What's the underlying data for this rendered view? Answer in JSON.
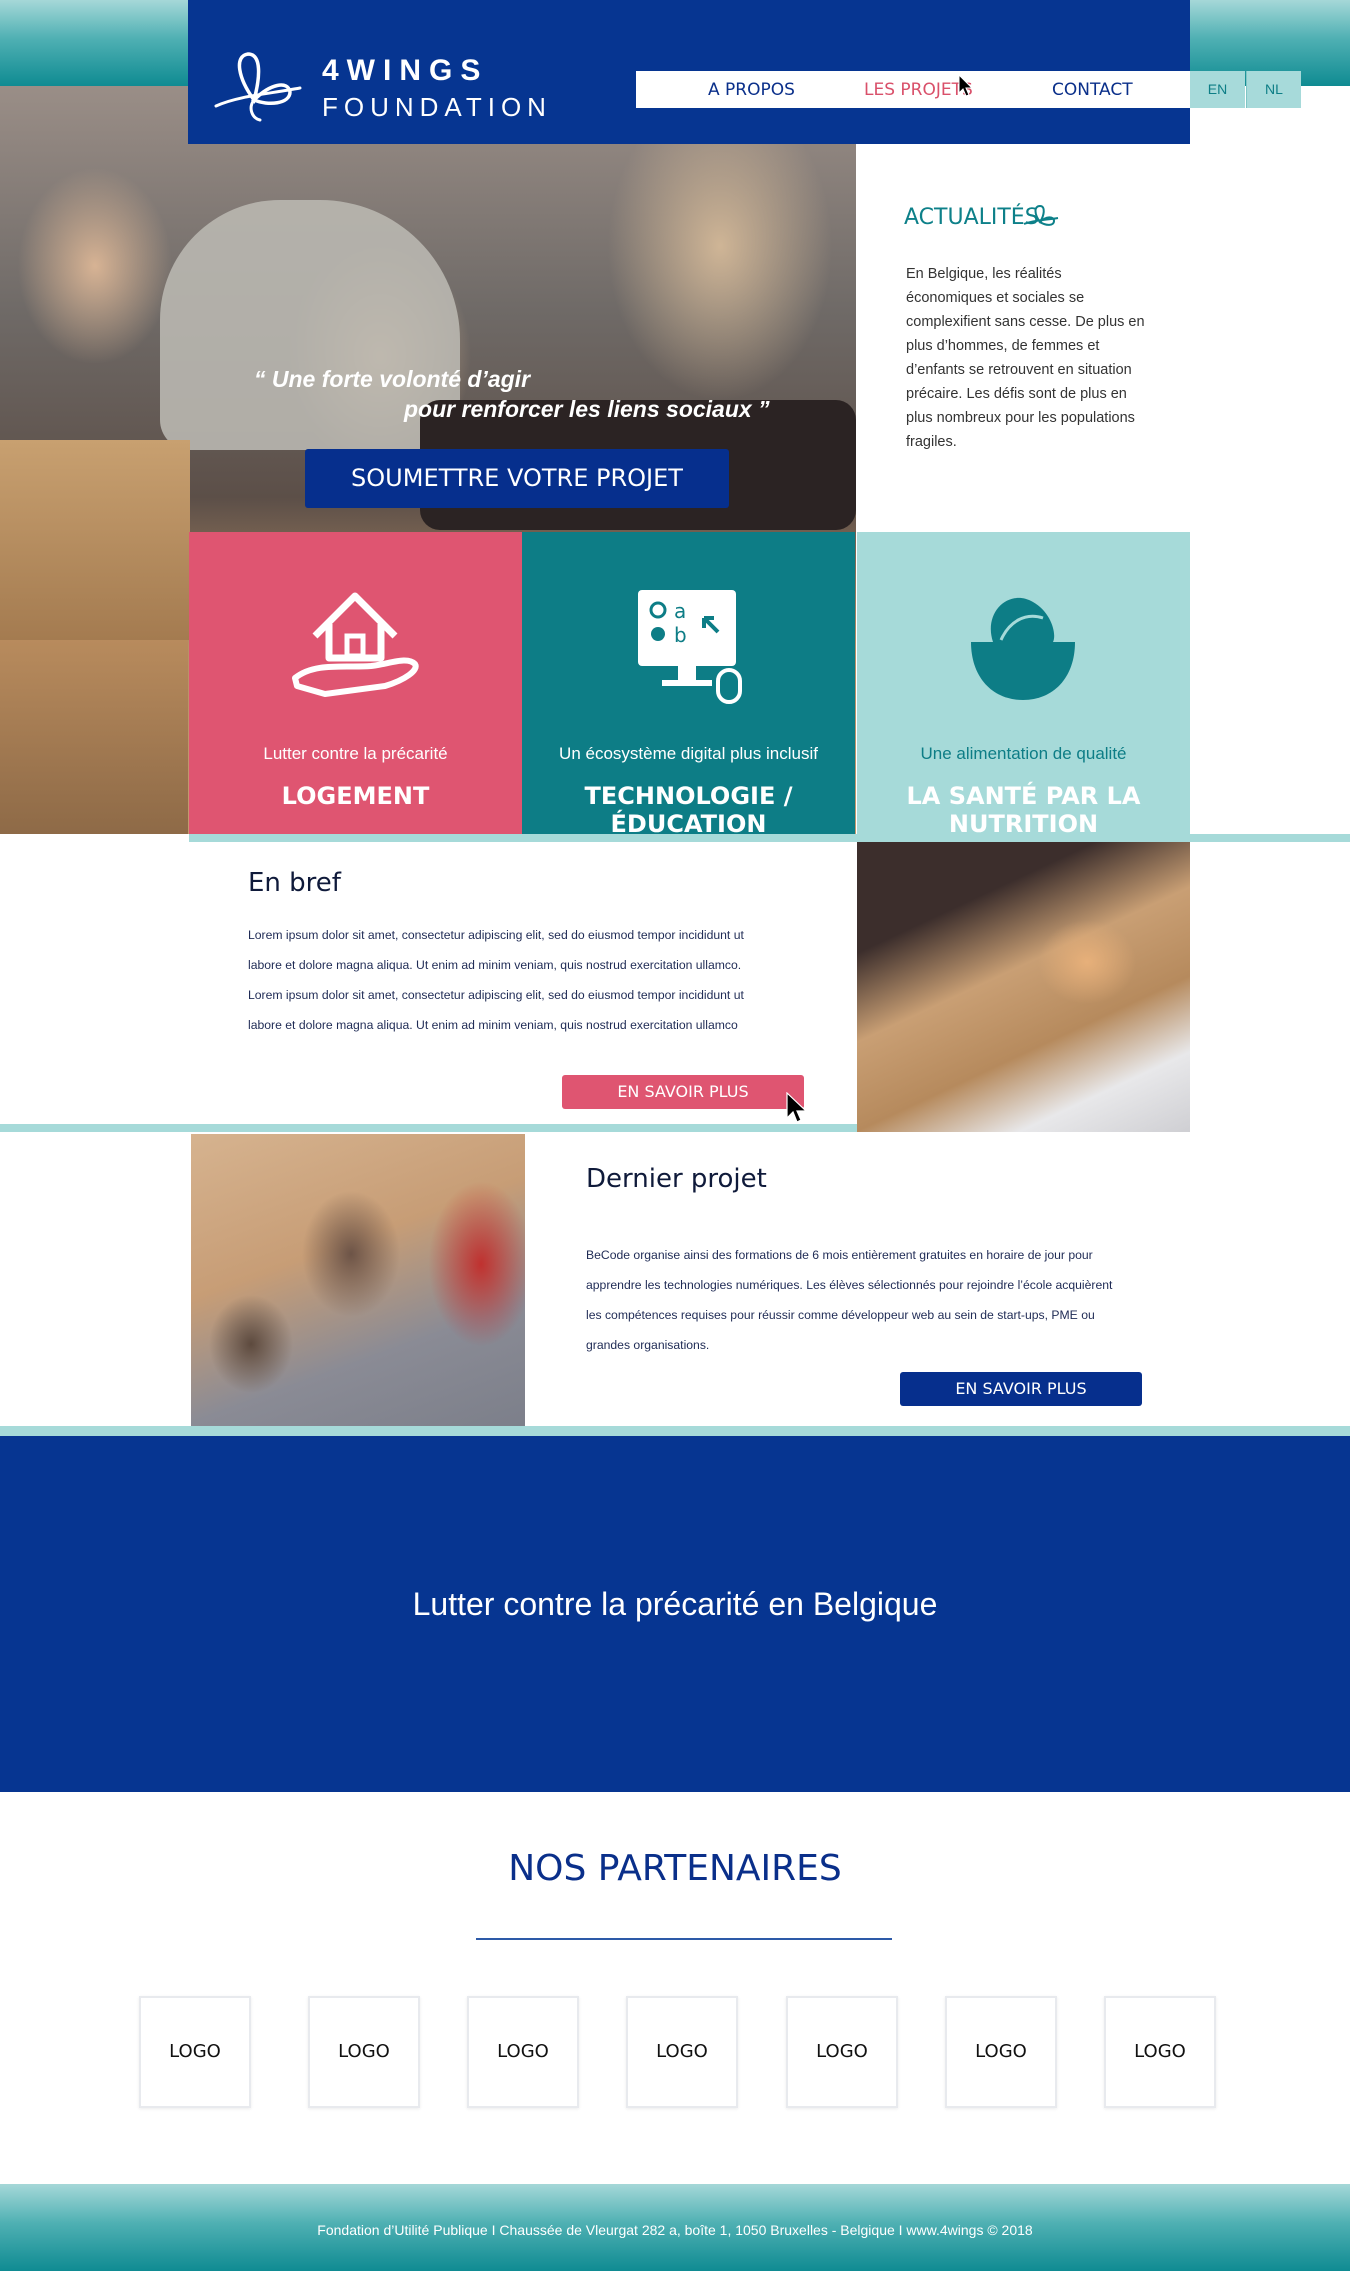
{
  "brand": {
    "line1": "4WINGS",
    "line2": "FOUNDATION"
  },
  "nav": [
    {
      "label": "A PROPOS"
    },
    {
      "label": "LES PROJETS"
    },
    {
      "label": "CONTACT"
    }
  ],
  "languages": [
    "EN",
    "NL"
  ],
  "hero": {
    "quote_line1": "“ Une forte volonté d’agir",
    "quote_line2": "pour renforcer les liens sociaux ”",
    "cta": "SOUMETTRE VOTRE PROJET"
  },
  "news": {
    "title": "ACTUALITÉS",
    "text": "En Belgique, les réalités économiques et sociales se complexifient sans cesse. De plus en plus d’hommes, de femmes et d’enfants se retrouvent en situation précaire. Les défis sont de plus en plus nombreux pour les populations fragiles."
  },
  "categories": [
    {
      "caption": "Lutter contre la précarité",
      "title": "LOGEMENT",
      "icon": "house-in-hand-icon"
    },
    {
      "caption": "Un écosystème digital plus inclusif",
      "title": "TECHNOLOGIE / ÉDUCATION",
      "icon": "computer-monitor-icon"
    },
    {
      "caption": "Une alimentation de qualité",
      "title": "LA SANTÉ PAR LA NUTRITION",
      "icon": "leaf-bowl-icon"
    }
  ],
  "brief": {
    "title": "En bref",
    "text": "Lorem ipsum dolor sit amet, consectetur adipiscing elit, sed do eiusmod tempor incididunt ut labore et dolore magna aliqua. Ut enim ad minim veniam, quis nostrud exercitation ullamco. Lorem ipsum dolor sit amet, consectetur adipiscing elit, sed do eiusmod tempor incididunt ut labore et dolore magna aliqua. Ut enim ad minim veniam, quis nostrud exercitation ullamco",
    "button": "EN SAVOIR PLUS"
  },
  "project": {
    "title": "Dernier projet",
    "text": "BeCode organise ainsi des formations de 6 mois entièrement gratuites en horaire de jour pour apprendre les technologies numériques.  Les élèves sélectionnés pour rejoindre l’école acquièrent les compétences requises pour réussir comme développeur web au sein de start-ups, PME ou grandes organisations.",
    "button": "EN SAVOIR PLUS"
  },
  "tagline": "Lutter contre la précarité en Belgique",
  "partners": {
    "title": "NOS PARTENAIRES",
    "logos": [
      "LOGO",
      "LOGO",
      "LOGO",
      "LOGO",
      "LOGO",
      "LOGO",
      "LOGO"
    ]
  },
  "footer": "Fondation d’Utilité Publique  I Chaussée de Vleurgat 282 a, boîte 1, 1050 Bruxelles - Belgique I www.4wings © 2018",
  "colors": {
    "navy": "#063591",
    "teal": "#0d7d86",
    "light_teal": "#a6dad9",
    "pink": "#df5571"
  }
}
